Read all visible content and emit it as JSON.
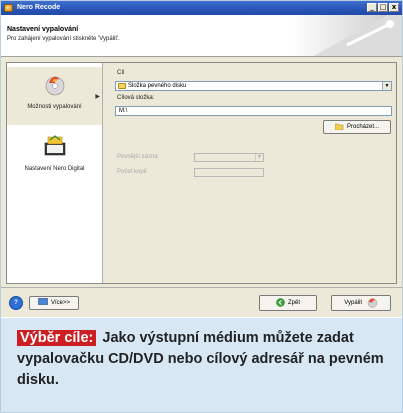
{
  "window": {
    "title": "Nero Recode",
    "controls": [
      "_",
      "□",
      "x"
    ]
  },
  "header": {
    "title": "Nastavení vypalování",
    "subtitle": "Pro zahájení vypalování stiskněte 'Vypálit'."
  },
  "sidebar": {
    "items": [
      {
        "label": "Možnosti vypalování",
        "icon": "burn-disc-icon"
      },
      {
        "label": "Nastavení Nero Digital",
        "icon": "nero-digital-icon"
      }
    ]
  },
  "form": {
    "target_label": "Cíl",
    "target_value": "Složka pevného disku",
    "dest_label": "Cílová složka:",
    "dest_value": "M:\\",
    "browse_label": "Procházet...",
    "burner_label": "Pevnější zázna",
    "copies_label": "Počet kopií"
  },
  "bottom": {
    "more_label": "Více>>",
    "back_label": "Zpět",
    "burn_label": "Vypálit"
  },
  "caption": {
    "tag": "Výběr cíle:",
    "text": "Jako výstupní médium můžete zadat vypalovačku CD/DVD nebo cílový adresář na pevném disku."
  },
  "colors": {
    "titlebar": "#2a56b8",
    "caption_bg": "#d8e7f4",
    "tag_bg": "#cc1f24"
  }
}
